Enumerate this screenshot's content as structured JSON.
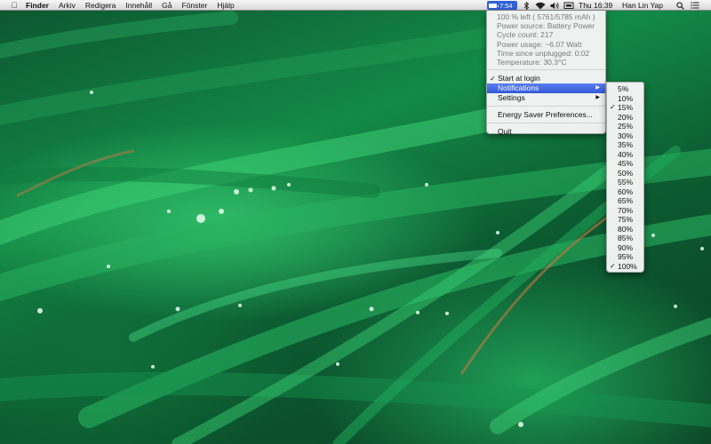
{
  "menubar": {
    "app_name": "Finder",
    "menus": [
      "Arkiv",
      "Redigera",
      "Innehåll",
      "Gå",
      "Fönster",
      "Hjälp"
    ],
    "battery_time": "7:54",
    "clock": "Thu 16:39",
    "user": "Han Lin Yap",
    "battery_level": 1.0
  },
  "battery_menu": {
    "info": [
      "100 % left ( 5761/5785 mAh )",
      "Power source: Battery Power",
      "Cycle count: 217",
      "Power usage: ~6.07 Watt",
      "Time since unplugged: 0:02",
      "Temperature: 30.3°C"
    ],
    "start_at_login": "Start at login",
    "notifications": "Notifications",
    "settings": "Settings",
    "energy_saver": "Energy Saver Preferences...",
    "quit": "Quit",
    "start_at_login_checked": true
  },
  "notifications_submenu": {
    "items": [
      "5%",
      "10%",
      "15%",
      "20%",
      "25%",
      "30%",
      "35%",
      "40%",
      "45%",
      "50%",
      "55%",
      "60%",
      "65%",
      "70%",
      "75%",
      "80%",
      "85%",
      "90%",
      "95%",
      "100%"
    ],
    "checked": [
      "15%",
      "100%"
    ]
  },
  "icons": {
    "apple": "apple-icon",
    "bluetooth": "bluetooth-icon",
    "wifi": "wifi-icon",
    "volume": "volume-icon",
    "display": "display-icon",
    "search": "spotlight-search-icon",
    "list": "notification-list-icon"
  },
  "colors": {
    "highlight": "#3a63dd",
    "battery_button": "#2f63d6",
    "wallpaper_green": "#138a47"
  }
}
